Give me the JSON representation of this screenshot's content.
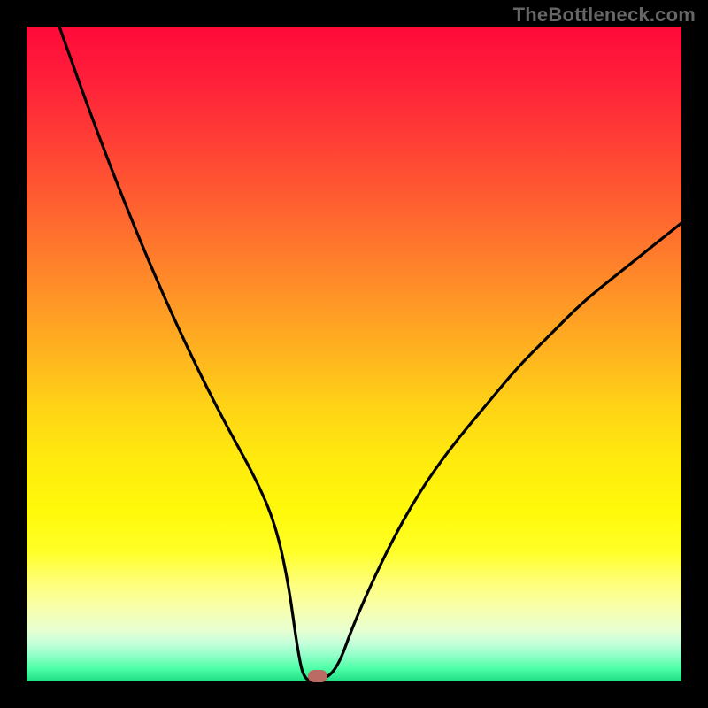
{
  "watermark": "TheBottleneck.com",
  "chart_data": {
    "type": "line",
    "title": "",
    "xlabel": "",
    "ylabel": "",
    "xlim": [
      0,
      100
    ],
    "ylim": [
      0,
      100
    ],
    "grid": false,
    "legend": false,
    "series": [
      {
        "name": "bottleneck-curve",
        "x": [
          5,
          10,
          15,
          20,
          25,
          30,
          35,
          38,
          40,
          41.5,
          42.5,
          45,
          47.5,
          50,
          55,
          60,
          65,
          70,
          75,
          80,
          85,
          90,
          95,
          100
        ],
        "y": [
          100,
          86,
          73,
          61,
          50,
          40,
          31,
          24,
          15,
          4,
          0,
          0,
          2,
          9,
          20,
          29,
          36,
          42,
          48,
          53,
          58,
          62,
          66,
          70
        ]
      }
    ],
    "marker": {
      "x": 44.5,
      "y": 0.8
    },
    "colors": {
      "curve": "#000000",
      "marker": "#bb6a64",
      "gradient_top": "#ff0a3a",
      "gradient_bottom": "#1fdd84"
    }
  }
}
